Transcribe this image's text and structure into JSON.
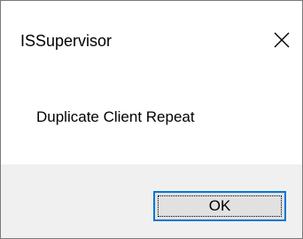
{
  "dialog": {
    "title": "ISSupervisor",
    "close_icon": "close-icon",
    "message": "Duplicate Client Repeat",
    "ok_label": "OK"
  },
  "colors": {
    "button_border": "#0078d7",
    "button_face": "#e1e1e1",
    "footer_bg": "#f0f0f0"
  }
}
